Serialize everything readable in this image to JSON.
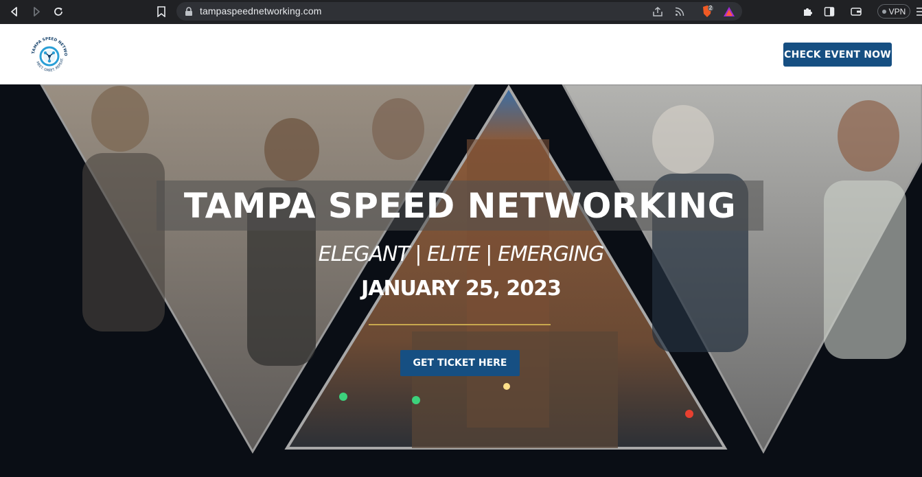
{
  "browser": {
    "url": "tampaspeednetworking.com",
    "shield_count": "2",
    "vpn_label": "VPN"
  },
  "header": {
    "logo_text_top": "TAMPA SPEED NETWORKING",
    "logo_text_bottom": "MEET. GREET. REPEAT.",
    "cta_label": "CHECK EVENT NOW"
  },
  "hero": {
    "title": "TAMPA SPEED NETWORKING",
    "tagline": "ELEGANT | ELITE | EMERGING",
    "date": "JANUARY 25, 2023",
    "ticket_label": "GET TICKET HERE"
  },
  "colors": {
    "brand_blue": "#164f82",
    "gold_divider": "#c8a84e",
    "hero_dark": "#0a0e15"
  }
}
